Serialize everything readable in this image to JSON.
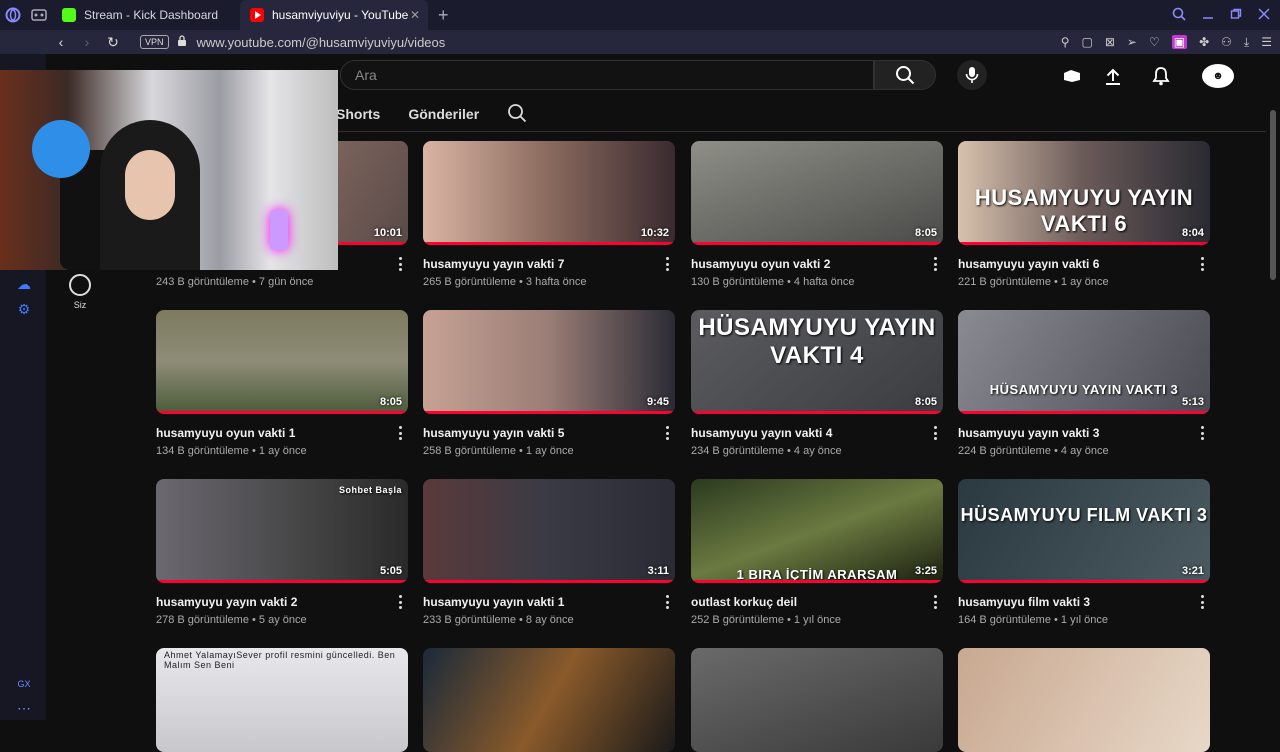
{
  "browser": {
    "tabs": [
      {
        "title": "Stream - Kick Dashboard",
        "active": false
      },
      {
        "title": "husamviyuviyu - YouTube",
        "active": true
      }
    ],
    "url": "www.youtube.com/@husamviyuviyu/videos",
    "vpn_label": "VPN"
  },
  "youtube": {
    "search_placeholder": "Ara",
    "channel_tabs": [
      "Shorts",
      "Gönderiler"
    ],
    "side_nav_you_label": "Siz",
    "videos": [
      {
        "title": "",
        "meta": "243 B görüntüleme • 7 gün önce",
        "duration": "10:01",
        "overlay": ""
      },
      {
        "title": "husamyuyu yayın vakti 7",
        "meta": "265 B görüntüleme • 3 hafta önce",
        "duration": "10:32",
        "overlay": ""
      },
      {
        "title": "husamyuyu oyun vakti 2",
        "meta": "130 B görüntüleme • 4 hafta önce",
        "duration": "8:05",
        "overlay": ""
      },
      {
        "title": "husamyuyu yayın vakti 6",
        "meta": "221 B görüntüleme • 1 ay önce",
        "duration": "8:04",
        "overlay": "HUSAMYUYU YAYIN VAKTI 6"
      },
      {
        "title": "husamyuyu oyun vakti 1",
        "meta": "134 B görüntüleme • 1 ay önce",
        "duration": "8:05",
        "overlay": ""
      },
      {
        "title": "husamyuyu yayın vakti 5",
        "meta": "258 B görüntüleme • 1 ay önce",
        "duration": "9:45",
        "overlay": ""
      },
      {
        "title": "husamyuyu yayın vakti 4",
        "meta": "234 B görüntüleme • 4 ay önce",
        "duration": "8:05",
        "overlay": "HÜSAMYUYU YAYIN VAKTI 4"
      },
      {
        "title": "husamyuyu yayın vakti 3",
        "meta": "224 B görüntüleme • 4 ay önce",
        "duration": "5:13",
        "overlay": "HÜSAMYUYU YAYIN VAKTI 3"
      },
      {
        "title": "husamyuyu yayın vakti 2",
        "meta": "278 B görüntüleme • 5 ay önce",
        "duration": "5:05",
        "overlay": "Sohbet Başla"
      },
      {
        "title": "husamyuyu yayın vakti 1",
        "meta": "233 B görüntüleme • 8 ay önce",
        "duration": "3:11",
        "overlay": ""
      },
      {
        "title": "outlast korkuç deil",
        "meta": "252 B görüntüleme • 1 yıl önce",
        "duration": "3:25",
        "overlay": "1 BIRA İÇTİM ARARSAM"
      },
      {
        "title": "husamyuyu film vakti 3",
        "meta": "164 B görüntüleme • 1 yıl önce",
        "duration": "3:21",
        "overlay": "HÜSAMYUYU FILM VAKTI 3"
      },
      {
        "title": "",
        "meta": "",
        "duration": "",
        "overlay": "Ahmet YalamayıSever profil resmini güncelledi. Ben Malım Sen Beni"
      },
      {
        "title": "",
        "meta": "",
        "duration": "",
        "overlay": ""
      },
      {
        "title": "",
        "meta": "",
        "duration": "",
        "overlay": ""
      },
      {
        "title": "",
        "meta": "",
        "duration": "",
        "overlay": ""
      }
    ]
  },
  "colors": {
    "accent": "#ff0033",
    "background": "#0f0f0f",
    "opera_blue": "#3d7bff"
  }
}
